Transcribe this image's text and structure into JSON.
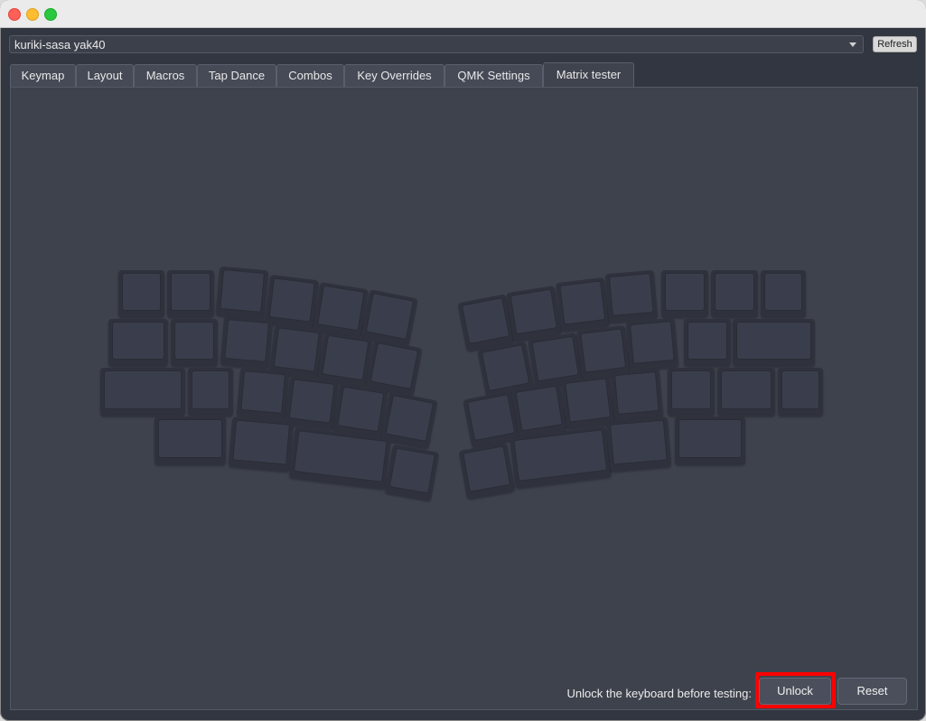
{
  "device": {
    "selected": "kuriki-sasa yak40"
  },
  "toolbar": {
    "refresh_label": "Refresh"
  },
  "tabs": [
    {
      "label": "Keymap"
    },
    {
      "label": "Layout"
    },
    {
      "label": "Macros"
    },
    {
      "label": "Tap Dance"
    },
    {
      "label": "Combos"
    },
    {
      "label": "Key Overrides"
    },
    {
      "label": "QMK Settings"
    },
    {
      "label": "Matrix tester"
    }
  ],
  "active_tab": "Matrix tester",
  "matrix": {
    "status_text": "Unlock the keyboard before testing:",
    "unlock_label": "Unlock",
    "reset_label": "Reset"
  },
  "colors": {
    "highlight": "#ff0000",
    "panel": "#3e424d",
    "key": "#3a3e4c"
  }
}
